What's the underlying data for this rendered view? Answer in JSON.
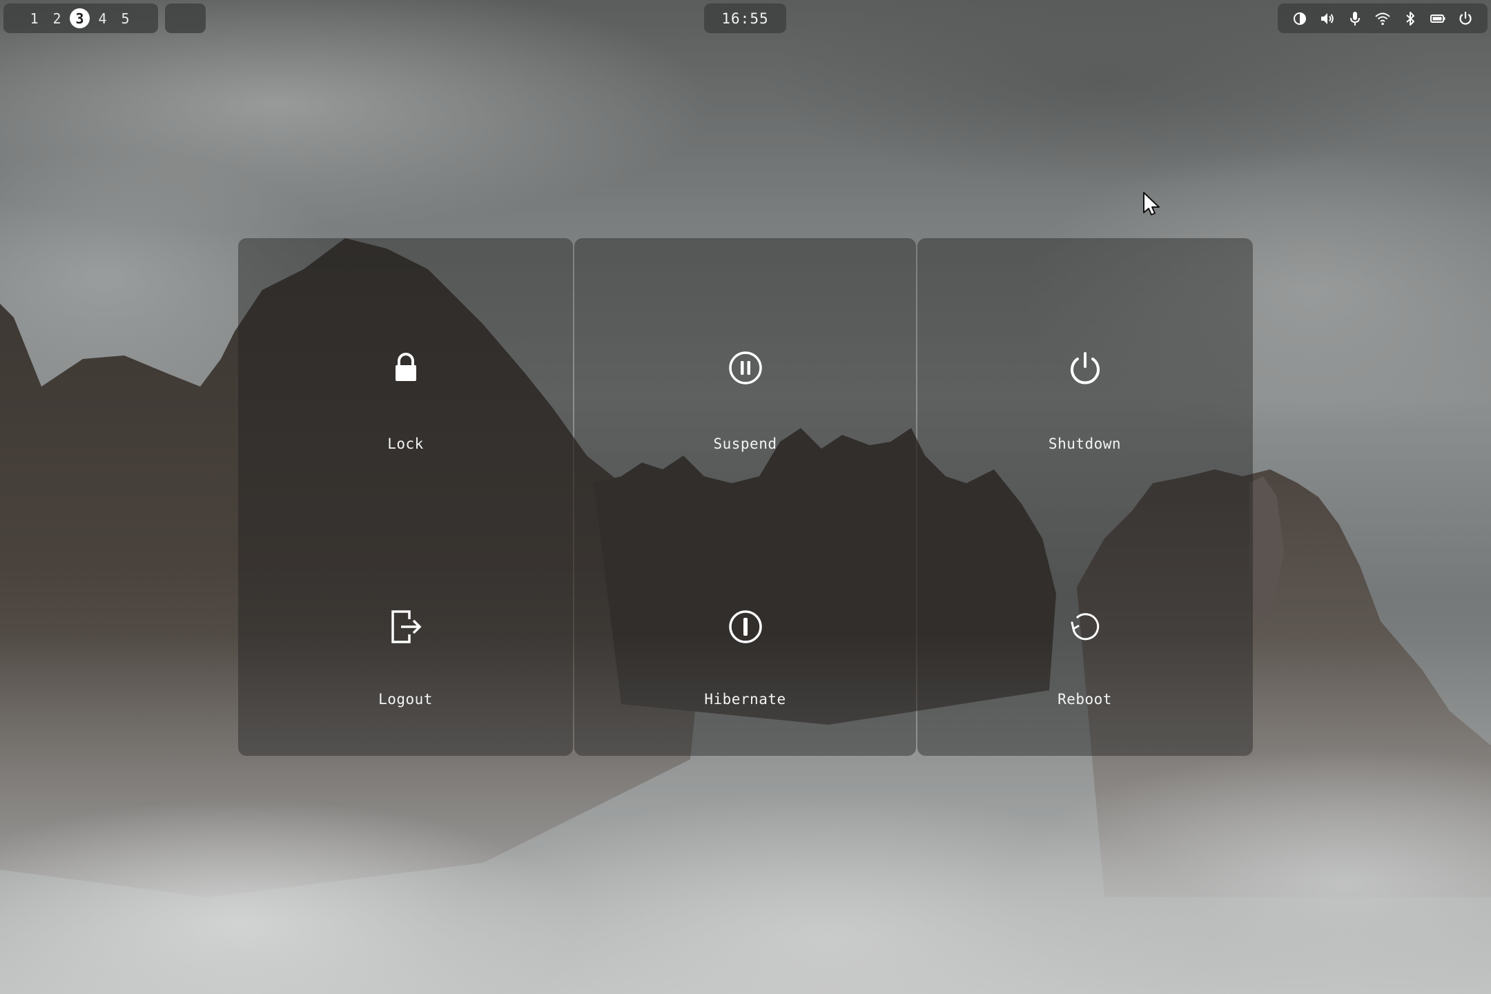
{
  "topbar": {
    "workspaces": [
      "1",
      "2",
      "3",
      "4",
      "5"
    ],
    "active_workspace": "3",
    "clock": "16:55",
    "tray_icons": [
      "contrast-icon",
      "volume-icon",
      "microphone-icon",
      "wifi-icon",
      "bluetooth-icon",
      "battery-icon",
      "power-icon"
    ]
  },
  "power_menu": {
    "options": [
      {
        "label": "Lock",
        "icon": "lock-icon"
      },
      {
        "label": "Suspend",
        "icon": "pause-circle-icon"
      },
      {
        "label": "Shutdown",
        "icon": "power-icon"
      },
      {
        "label": "Logout",
        "icon": "logout-icon"
      },
      {
        "label": "Hibernate",
        "icon": "hibernate-icon"
      },
      {
        "label": "Reboot",
        "icon": "reboot-icon"
      }
    ]
  },
  "colors": {
    "panel": "#3e4040",
    "menu_tile": "#2b2c2c",
    "active_workspace": "#ffffff",
    "text": "#f2f2f2"
  }
}
